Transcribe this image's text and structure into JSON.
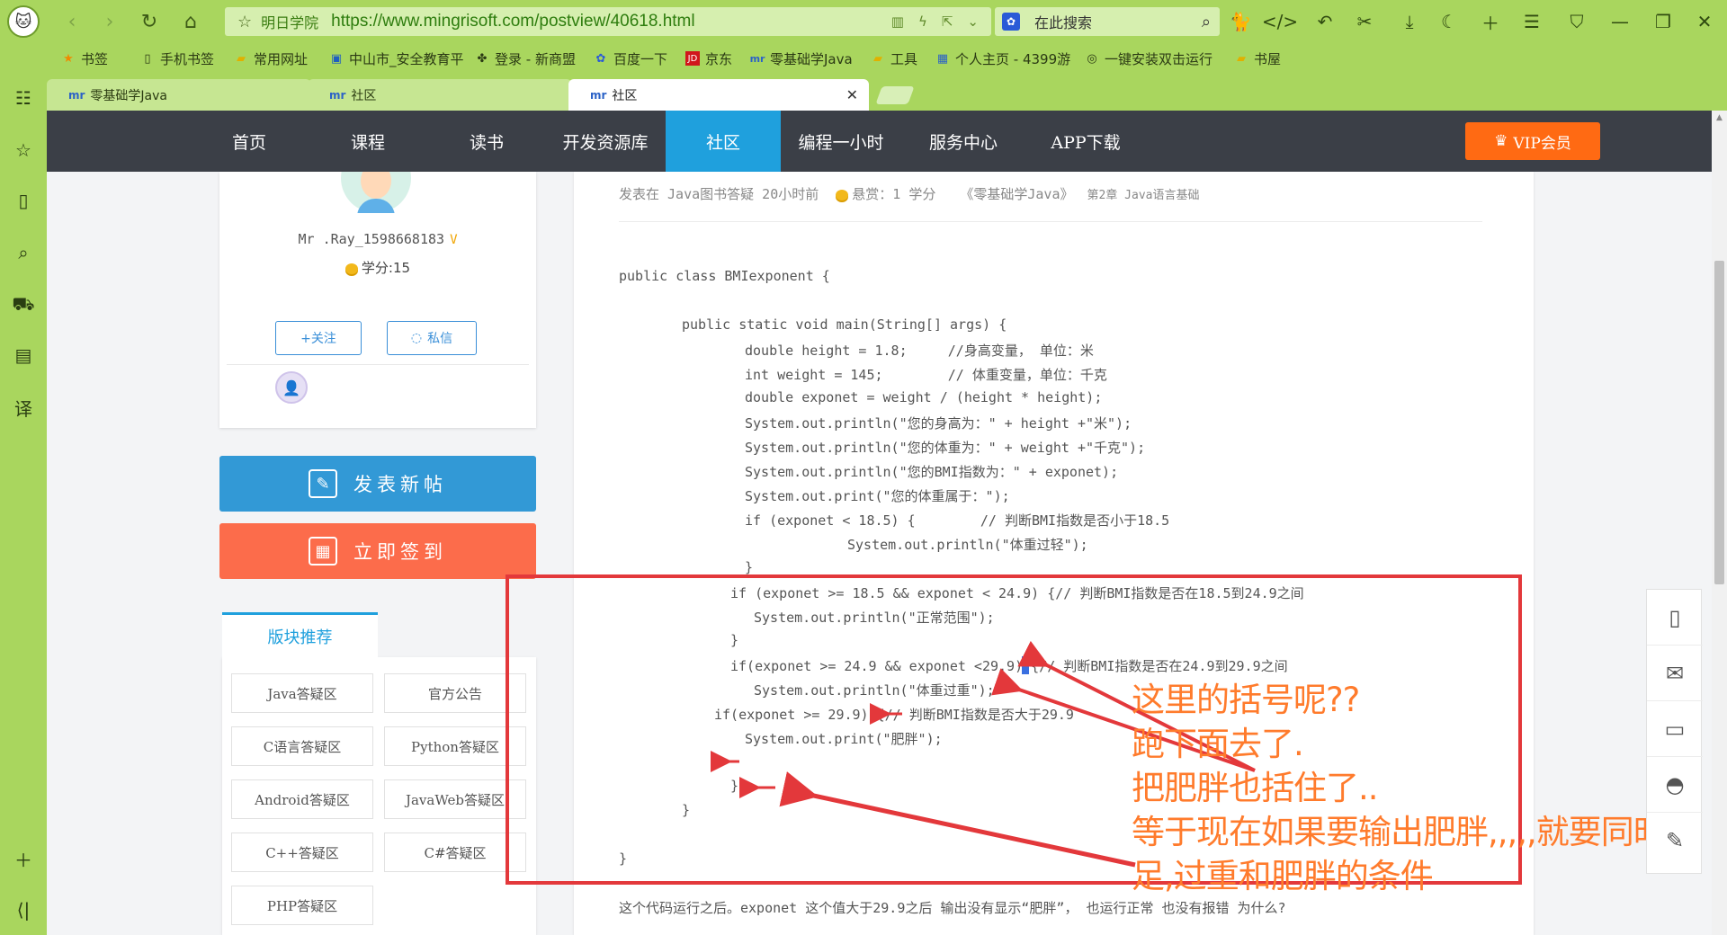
{
  "browser": {
    "site_name": "明日学院",
    "url": "https://www.mingrisoft.com/postview/40618.html",
    "search_placeholder": "在此搜索",
    "bookmarks": [
      {
        "label": "书签"
      },
      {
        "label": "手机书签"
      },
      {
        "label": "常用网址"
      },
      {
        "label": "中山市_安全教育平"
      },
      {
        "label": "登录 - 新商盟"
      },
      {
        "label": "百度一下"
      },
      {
        "label": "京东"
      },
      {
        "label": "零基础学Java"
      },
      {
        "label": "工具"
      },
      {
        "label": "个人主页 - 4399游"
      },
      {
        "label": "一键安装双击运行"
      },
      {
        "label": "书屋"
      }
    ],
    "tabs": [
      {
        "label": "零基础学Java"
      },
      {
        "label": "社区"
      },
      {
        "label": "社区"
      }
    ]
  },
  "site_nav": {
    "items": [
      {
        "label": "首页"
      },
      {
        "label": "课程"
      },
      {
        "label": "读书"
      },
      {
        "label": "开发资源库"
      },
      {
        "label": "社区"
      },
      {
        "label": "编程一小时"
      },
      {
        "label": "服务中心"
      },
      {
        "label": "APP下载"
      }
    ],
    "active_index": 4,
    "vip_label": "VIP会员",
    "accent": "#1fa0dd",
    "vip_color": "#ff6a13"
  },
  "profile": {
    "username": "Mr .Ray_1598668183",
    "credits": "学分:15",
    "follow_label": "+关注",
    "message_label": "私信"
  },
  "actions": {
    "post_label": "发表新帖",
    "signin_label": "立即签到"
  },
  "blocks": {
    "title": "版块推荐",
    "items": [
      {
        "label": "Java答疑区"
      },
      {
        "label": "官方公告"
      },
      {
        "label": "C语言答疑区"
      },
      {
        "label": "Python答疑区"
      },
      {
        "label": "Android答疑区"
      },
      {
        "label": "JavaWeb答疑区"
      },
      {
        "label": "C++答疑区"
      },
      {
        "label": "C#答疑区"
      },
      {
        "label": "PHP答疑区"
      }
    ]
  },
  "post": {
    "meta": "发表在 Java图书答疑 20小时前",
    "reward": "悬赏：1 学分",
    "book": "《零基础学Java》",
    "chapter": "第2章 Java语言基础",
    "code_lines": [
      "public class BMIexponent {",
      "public static void main(String[] args) {",
      "double height = 1.8;     //身高变量， 单位：米",
      "int weight = 145;        // 体重变量，单位：千克",
      "double exponet = weight / (height * height);",
      "System.out.println(\"您的身高为：\" + height +\"米\");",
      "System.out.println(\"您的体重为：\" + weight +\"千克\");",
      "System.out.println(\"您的BMI指数为：\" + exponet);",
      "System.out.print(\"您的体重属于：\");",
      "if (exponet < 18.5) {        // 判断BMI指数是否小于18.5",
      "System.out.println(\"体重过轻\");",
      "}",
      "if (exponet >= 18.5 && exponet < 24.9) {// 判断BMI指数是否在18.5到24.9之间",
      "System.out.println(\"正常范围\");",
      "}",
      "if(exponet >= 24.9 && exponet <29.9) {// 判断BMI指数是否在24.9到29.9之间",
      "System.out.println(\"体重过重\");",
      "if(exponet >= 29.9) {// 判断BMI指数是否大于29.9",
      "System.out.print(\"肥胖\");",
      "}",
      "}",
      "}",
      "}"
    ],
    "annotation": [
      "这里的括号呢??",
      "跑下面去了.",
      "把肥胖也括住了..",
      "等于现在如果要输出肥胖,,,,,就要同时满",
      "足,过重和肥胖的条件"
    ],
    "question": "这个代码运行之后。exponet 这个值大于29.9之后 输出没有显示“肥胖”， 也运行正常 也没有报错 为什么?"
  },
  "colors": {
    "chrome_green": "#a9d65e",
    "nav_dark": "#3b3f47",
    "post_button": "#3299d6",
    "signin_button": "#fc6c4b",
    "annotation_red": "#e3383b",
    "annotation_text": "#ff7b2c"
  },
  "icons": {
    "left_sidebar": [
      "news-icon",
      "star-icon",
      "book-icon",
      "search-icon",
      "cart-icon",
      "bag-icon",
      "translate-icon",
      "plus-icon",
      "collapse-icon"
    ],
    "float_toolbar": [
      "phone-icon",
      "mail-icon",
      "chat-icon",
      "qq-icon",
      "edit-icon"
    ]
  }
}
